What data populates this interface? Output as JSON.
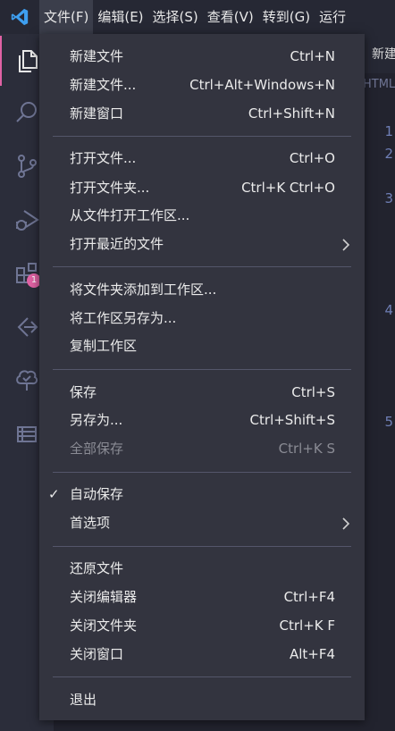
{
  "menubar": {
    "items": [
      "文件(F)",
      "编辑(E)",
      "选择(S)",
      "查看(V)",
      "转到(G)",
      "运行"
    ]
  },
  "activity": {
    "extensions_badge": "1"
  },
  "editor": {
    "tab_label": "新建",
    "breadcrumb": "HTML",
    "line_numbers": [
      "1",
      "2",
      "3",
      "4",
      "5"
    ]
  },
  "file_menu": {
    "new_file": {
      "label": "新建文件",
      "shortcut": "Ctrl+N"
    },
    "new_file_ellipsis": {
      "label": "新建文件...",
      "shortcut": "Ctrl+Alt+Windows+N"
    },
    "new_window": {
      "label": "新建窗口",
      "shortcut": "Ctrl+Shift+N"
    },
    "open_file": {
      "label": "打开文件...",
      "shortcut": "Ctrl+O"
    },
    "open_folder": {
      "label": "打开文件夹...",
      "shortcut": "Ctrl+K Ctrl+O"
    },
    "open_workspace": {
      "label": "从文件打开工作区..."
    },
    "open_recent": {
      "label": "打开最近的文件"
    },
    "add_folder": {
      "label": "将文件夹添加到工作区..."
    },
    "save_workspace_as": {
      "label": "将工作区另存为..."
    },
    "duplicate_workspace": {
      "label": "复制工作区"
    },
    "save": {
      "label": "保存",
      "shortcut": "Ctrl+S"
    },
    "save_as": {
      "label": "另存为...",
      "shortcut": "Ctrl+Shift+S"
    },
    "save_all": {
      "label": "全部保存",
      "shortcut": "Ctrl+K S"
    },
    "auto_save": {
      "label": "自动保存",
      "checked_mark": "✓"
    },
    "preferences": {
      "label": "首选项"
    },
    "revert_file": {
      "label": "还原文件"
    },
    "close_editor": {
      "label": "关闭编辑器",
      "shortcut": "Ctrl+F4"
    },
    "close_folder": {
      "label": "关闭文件夹",
      "shortcut": "Ctrl+K F"
    },
    "close_window": {
      "label": "关闭窗口",
      "shortcut": "Alt+F4"
    },
    "exit": {
      "label": "退出"
    }
  },
  "colors": {
    "accent": "#e062a4",
    "logo_blue": "#3e9ff0",
    "menu_bg": "#33343f"
  }
}
